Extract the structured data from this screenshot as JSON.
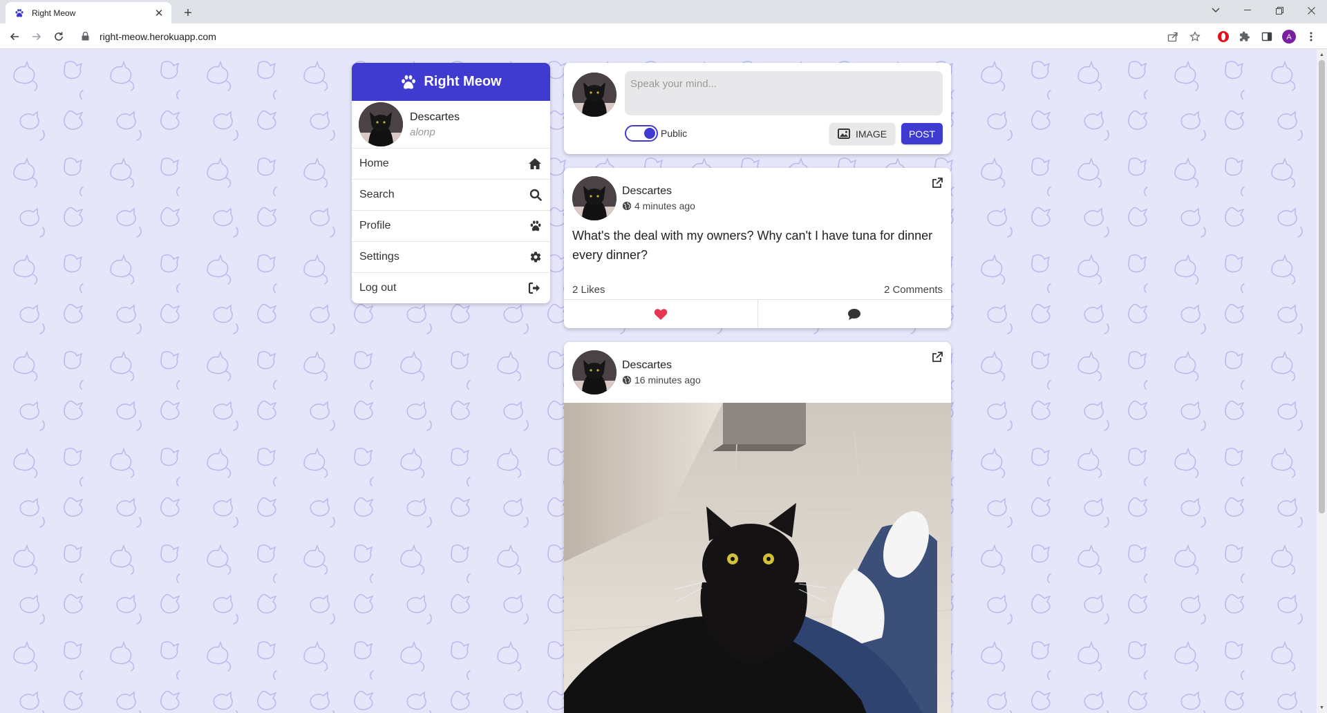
{
  "browser": {
    "tab_title": "Right Meow",
    "url": "right-meow.herokuapp.com",
    "profile_initial": "A",
    "colors": {
      "tab_favicon": "#3f3bd0",
      "profile": "#7b1fa2",
      "opera": "#e3101c"
    }
  },
  "app": {
    "brand": "Right Meow",
    "colors": {
      "primary": "#3f3bd0",
      "background": "#e6e6fb",
      "heart": "#e8344e"
    }
  },
  "sidebar": {
    "user": {
      "display_name": "Descartes",
      "username": "alonp"
    },
    "items": [
      {
        "label": "Home",
        "icon": "home-icon"
      },
      {
        "label": "Search",
        "icon": "search-icon"
      },
      {
        "label": "Profile",
        "icon": "paw-icon"
      },
      {
        "label": "Settings",
        "icon": "gear-icon"
      },
      {
        "label": "Log out",
        "icon": "logout-icon"
      }
    ]
  },
  "composer": {
    "placeholder": "Speak your mind...",
    "visibility_label": "Public",
    "image_button": "IMAGE",
    "post_button": "POST"
  },
  "posts": [
    {
      "author": "Descartes",
      "time": "4 minutes ago",
      "text": "What's the deal with my owners? Why can't I have tuna for dinner every dinner?",
      "likes": "2 Likes",
      "comments": "2 Comments"
    },
    {
      "author": "Descartes",
      "time": "16 minutes ago"
    }
  ]
}
